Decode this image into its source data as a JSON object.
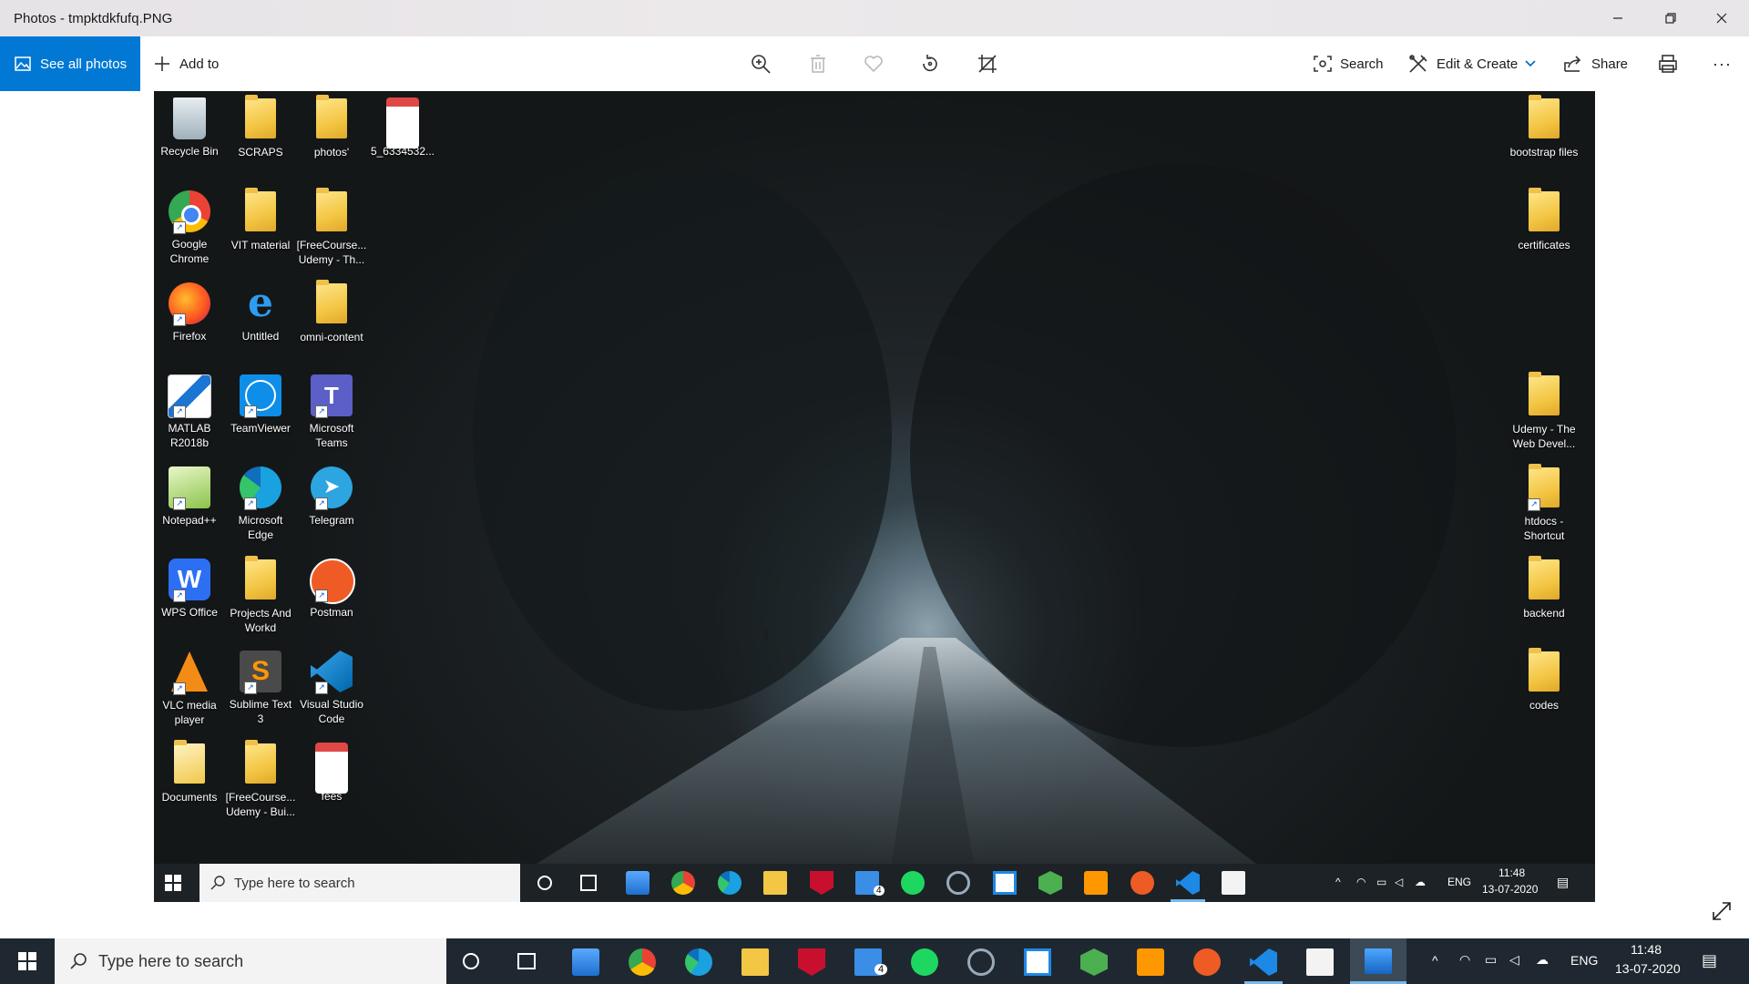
{
  "window": {
    "title": "Photos - tmpktdkfufq.PNG"
  },
  "toolbar": {
    "see_all_photos": "See all photos",
    "add_to": "Add to",
    "search": "Search",
    "edit_create": "Edit & Create",
    "share": "Share",
    "more": "···"
  },
  "desktop": {
    "icons_left": [
      {
        "label": "Recycle Bin",
        "icon": "recycle-bin-icon"
      },
      {
        "label": "SCRAPS",
        "icon": "folder-icon"
      },
      {
        "label": "photos'",
        "icon": "folder-icon"
      },
      {
        "label": "5_6334532...",
        "icon": "pdf-file-icon"
      },
      {
        "label": "Google Chrome",
        "icon": "chrome-icon"
      },
      {
        "label": "VIT material",
        "icon": "folder-icon"
      },
      {
        "label": "[FreeCourse... Udemy - Th...",
        "icon": "folder-icon"
      },
      {
        "label": "Firefox",
        "icon": "firefox-icon"
      },
      {
        "label": "Untitled",
        "icon": "internet-explorer-icon"
      },
      {
        "label": "omni-content",
        "icon": "folder-icon"
      },
      {
        "label": "MATLAB R2018b",
        "icon": "matlab-icon"
      },
      {
        "label": "TeamViewer",
        "icon": "teamviewer-icon"
      },
      {
        "label": "Microsoft Teams",
        "icon": "teams-icon"
      },
      {
        "label": "Notepad++",
        "icon": "notepadpp-icon"
      },
      {
        "label": "Microsoft Edge",
        "icon": "edge-icon"
      },
      {
        "label": "Telegram",
        "icon": "telegram-icon"
      },
      {
        "label": "WPS Office",
        "icon": "wps-office-icon"
      },
      {
        "label": "Projects And Workd",
        "icon": "folder-icon"
      },
      {
        "label": "Postman",
        "icon": "postman-icon"
      },
      {
        "label": "VLC media player",
        "icon": "vlc-icon"
      },
      {
        "label": "Sublime Text 3",
        "icon": "sublime-text-icon"
      },
      {
        "label": "Visual Studio Code",
        "icon": "vscode-icon"
      },
      {
        "label": "Documents",
        "icon": "documents-folder-icon"
      },
      {
        "label": "[FreeCourse... Udemy - Bui...",
        "icon": "folder-icon"
      },
      {
        "label": "fees",
        "icon": "pdf-file-icon"
      }
    ],
    "icons_right": [
      {
        "label": "bootstrap files"
      },
      {
        "label": "certificates"
      },
      {
        "label": "Udemy - The Web Devel..."
      },
      {
        "label": "htdocs - Shortcut"
      },
      {
        "label": "backend"
      },
      {
        "label": "codes"
      }
    ]
  },
  "inner_taskbar": {
    "search_placeholder": "Type here to search",
    "lang": "ENG",
    "time": "11:48",
    "date": "13-07-2020",
    "mail_badge": "4"
  },
  "taskbar": {
    "search_placeholder": "Type here to search",
    "lang": "ENG",
    "time": "11:48",
    "date": "13-07-2020",
    "mail_badge": "4"
  },
  "colors": {
    "accent": "#0078d4",
    "taskbar": "#1f2830",
    "folder": "#f3c644"
  }
}
